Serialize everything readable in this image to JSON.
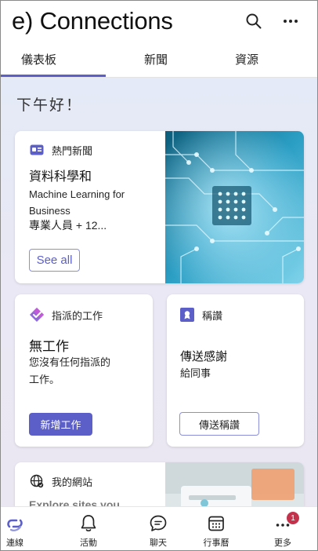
{
  "header": {
    "title": "e) Connections"
  },
  "tabs": [
    {
      "label": "儀表板",
      "active": true
    },
    {
      "label": "新聞",
      "active": false
    },
    {
      "label": "資源",
      "active": false
    }
  ],
  "greeting": "下午好！",
  "news_card": {
    "heading": "熱門新聞",
    "title": "資料科學和",
    "body": "Machine Learning for Business",
    "subtitle": "專業人員 + 12...",
    "button": "See all"
  },
  "tasks_card": {
    "heading": "指派的工作",
    "title": "無工作",
    "body": "您沒有任何指派的工作。",
    "button": "新增工作"
  },
  "praise_card": {
    "heading": "稱讚",
    "title": "傳送感謝",
    "subtitle": "給同事",
    "button": "傳送稱讚"
  },
  "sites_card": {
    "heading": "我的網站",
    "text": "Explore sites you"
  },
  "bottom_nav": [
    {
      "label": "連線",
      "icon": "connections-icon",
      "active": true
    },
    {
      "label": "活動",
      "icon": "bell-icon",
      "active": false
    },
    {
      "label": "聊天",
      "icon": "chat-icon",
      "active": false
    },
    {
      "label": "行事曆",
      "icon": "calendar-icon",
      "active": false
    },
    {
      "label": "更多",
      "icon": "more-icon",
      "active": false,
      "badge": "1"
    }
  ],
  "colors": {
    "accent": "#5b5fc7",
    "badge": "#c4314b",
    "background_tint": "#e6eaf6"
  }
}
